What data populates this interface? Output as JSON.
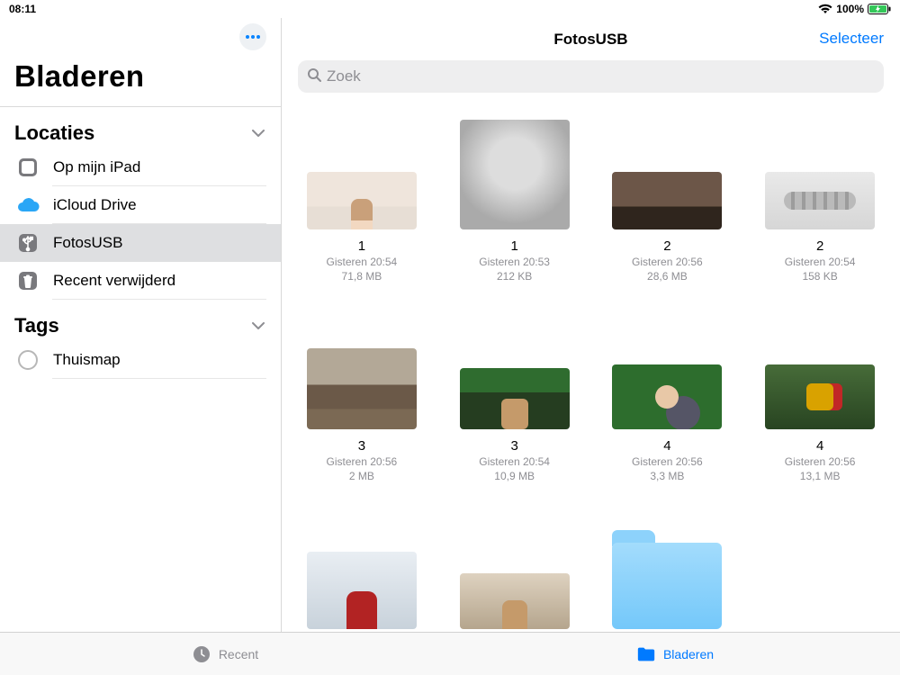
{
  "status": {
    "time": "08:11",
    "battery_pct": "100%"
  },
  "sidebar": {
    "title": "Bladeren",
    "sections": {
      "locations": {
        "header": "Locaties",
        "items": [
          {
            "label": "Op mijn iPad"
          },
          {
            "label": "iCloud Drive"
          },
          {
            "label": "FotosUSB"
          },
          {
            "label": "Recent verwijderd"
          }
        ]
      },
      "tags": {
        "header": "Tags",
        "items": [
          {
            "label": "Thuismap"
          }
        ]
      }
    }
  },
  "content": {
    "title": "FotosUSB",
    "select_label": "Selecteer",
    "search_placeholder": "Zoek",
    "items": [
      {
        "name": "1",
        "date": "Gisteren 20:54",
        "size": "71,8 MB"
      },
      {
        "name": "1",
        "date": "Gisteren 20:53",
        "size": "212 KB"
      },
      {
        "name": "2",
        "date": "Gisteren 20:56",
        "size": "28,6 MB"
      },
      {
        "name": "2",
        "date": "Gisteren 20:54",
        "size": "158 KB"
      },
      {
        "name": "3",
        "date": "Gisteren 20:56",
        "size": "2 MB"
      },
      {
        "name": "3",
        "date": "Gisteren 20:54",
        "size": "10,9 MB"
      },
      {
        "name": "4",
        "date": "Gisteren 20:56",
        "size": "3,3 MB"
      },
      {
        "name": "4",
        "date": "Gisteren 20:56",
        "size": "13,1 MB"
      },
      {
        "name": "",
        "date": "",
        "size": ""
      },
      {
        "name": "",
        "date": "",
        "size": ""
      },
      {
        "name": "",
        "date": "",
        "size": ""
      }
    ]
  },
  "tabbar": {
    "recent": "Recent",
    "browse": "Bladeren"
  }
}
